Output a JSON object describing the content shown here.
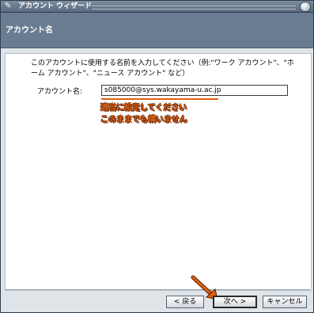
{
  "window": {
    "title": "アカウント ウィザード"
  },
  "header": {
    "title": "アカウント名"
  },
  "content": {
    "description": "このアカウントに使用する名前を入力してください（例:\"ワーク アカウント\"、\"ホーム アカウント\"、\"ニュース アカウント\" など）",
    "account_name_label": "アカウント名:",
    "account_name_value": "s085000@sys.wakayama-u.ac.jp",
    "annotation_line1": "適当に設定してください",
    "annotation_line2": "このままでも構いません"
  },
  "buttons": {
    "back": "< 戻る",
    "next": "次へ >",
    "cancel": "キャンセル"
  },
  "colors": {
    "annotation": "#e06010",
    "header": "#6a7c92"
  }
}
